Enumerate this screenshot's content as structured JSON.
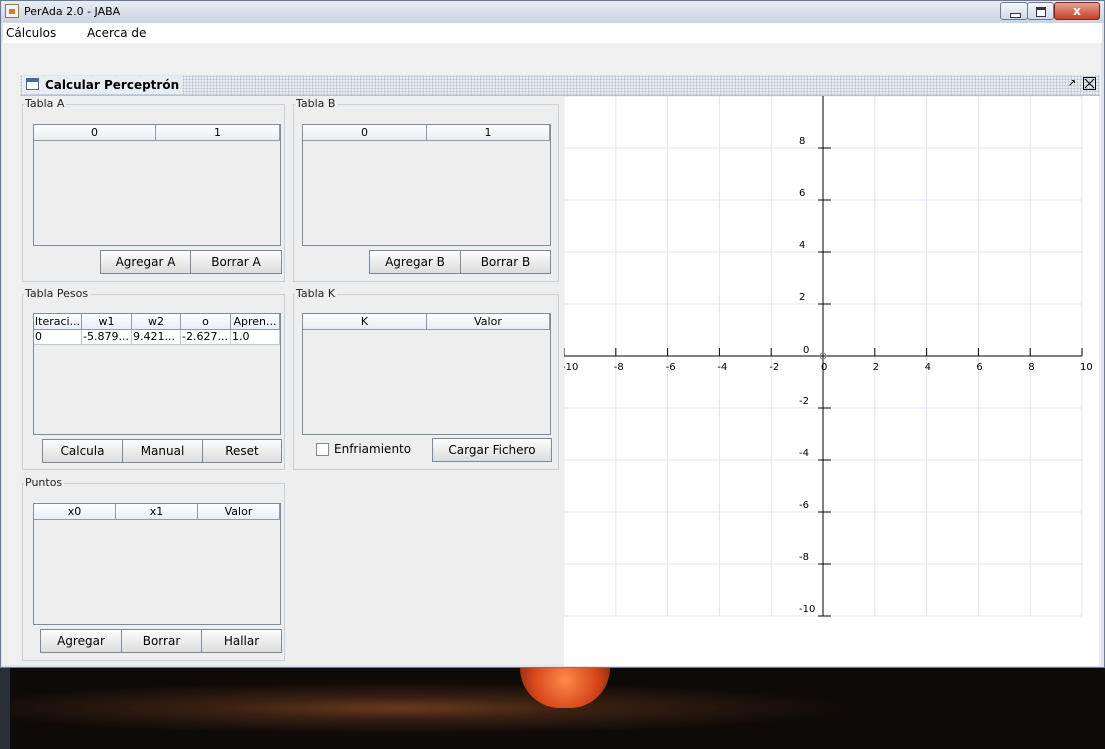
{
  "window": {
    "title": "PerAda 2.0 - JABA",
    "close_glyph": "x",
    "close_color": "#c4402a"
  },
  "menubar": {
    "items": [
      "Cálculos",
      "Acerca de"
    ]
  },
  "internal_frame": {
    "title": "Calcular Perceptrón",
    "icons": [
      "window-icon",
      "restore-icon",
      "close-icon"
    ]
  },
  "tabla_a": {
    "title": "Tabla A",
    "columns": [
      "0",
      "1"
    ],
    "add_label": "Agregar A",
    "delete_label": "Borrar A"
  },
  "tabla_b": {
    "title": "Tabla B",
    "columns": [
      "0",
      "1"
    ],
    "add_label": "Agregar B",
    "delete_label": "Borrar B"
  },
  "tabla_pesos": {
    "title": "Tabla Pesos",
    "columns": [
      "Iteraci...",
      "w1",
      "w2",
      "o",
      "Apren..."
    ],
    "rows": [
      [
        "0",
        "-5.879...",
        "9.421...",
        "-2.627...",
        "1.0"
      ]
    ],
    "buttons": [
      "Calcula",
      "Manual",
      "Reset"
    ]
  },
  "tabla_k": {
    "title": "Tabla K",
    "columns": [
      "K",
      "Valor"
    ],
    "checkbox_label": "Enfriamiento",
    "checkbox_checked": false,
    "load_label": "Cargar Fichero"
  },
  "puntos": {
    "title": "Puntos",
    "columns": [
      "x0",
      "x1",
      "Valor"
    ],
    "buttons": [
      "Agregar",
      "Borrar",
      "Hallar"
    ]
  },
  "plot": {
    "xlim": [
      -10,
      10
    ],
    "ylim": [
      -10,
      10
    ],
    "x_ticks": [
      "-10",
      "-8",
      "-6",
      "-4",
      "-2",
      "0",
      "2",
      "4",
      "6",
      "8",
      "10"
    ],
    "y_ticks": [
      "8",
      "6",
      "4",
      "2",
      "0",
      "-2",
      "-4",
      "-6",
      "-8",
      "-10"
    ],
    "grid_color": "#dfe6f2",
    "axis_color": "#000000"
  }
}
